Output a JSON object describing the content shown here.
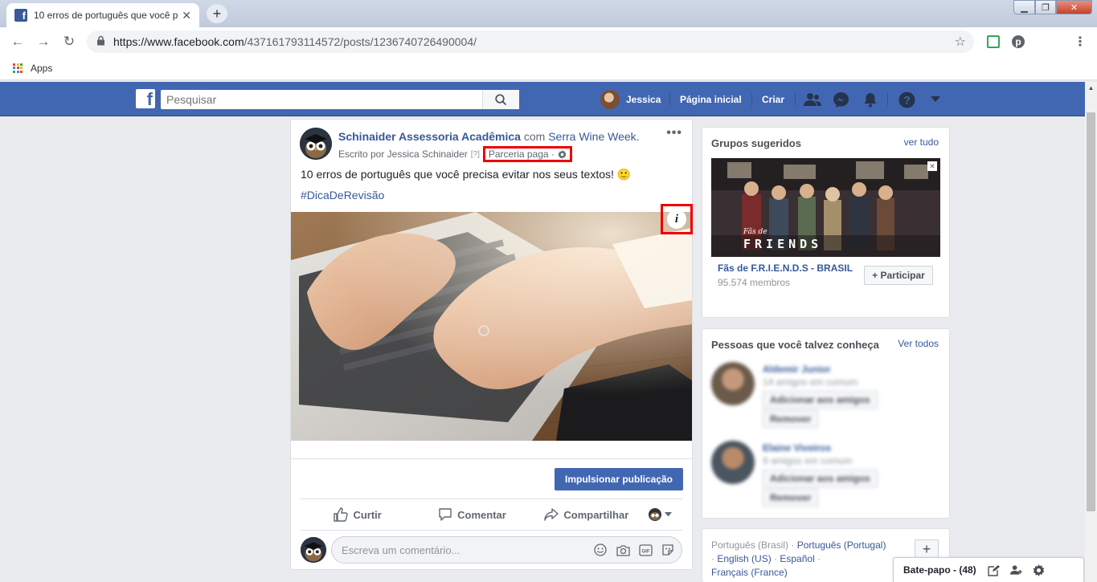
{
  "browser": {
    "tab_title": "10 erros de português que você p",
    "url_host": "https://www.facebook.com",
    "url_path": "/437161793114572/posts/1236740726490004/",
    "bookmarks_apps": "Apps"
  },
  "fb": {
    "search_placeholder": "Pesquisar",
    "user_name": "Jessica",
    "nav_home": "Página inicial",
    "nav_create": "Criar"
  },
  "post": {
    "page_name": "Schinaider Assessoria Acadêmica",
    "with_text": "com",
    "with_page": "Serra Wine Week.",
    "written_by": "Escrito por Jessica Schinaider",
    "written_by_help": "[?]",
    "paid_partnership": "Parceria paga ·",
    "text": "10 erros de português que você precisa evitar nos seus textos! 🙂",
    "hashtag": "#DicaDeRevisão",
    "boost_label": "Impulsionar publicação",
    "like_label": "Curtir",
    "comment_label": "Comentar",
    "share_label": "Compartilhar",
    "comment_placeholder": "Escreva um comentário..."
  },
  "groups": {
    "title": "Grupos sugeridos",
    "see_all": "ver tudo",
    "group_name": "Fãs de F.R.I.E.N.D.S - BRASIL",
    "members": "95.574 membros",
    "join_label": "+ Participar",
    "image_caption_top": "Fãs de",
    "image_caption_main": "FRIENDS"
  },
  "people": {
    "title": "Pessoas que você talvez conheça",
    "see_all": "Ver todos",
    "items": [
      {
        "name": "Aldemir Junior",
        "mutual": "14 amigos em comum",
        "add": "Adicionar aos amigos",
        "remove": "Remover"
      },
      {
        "name": "Elaine Viveiros",
        "mutual": "9 amigos em comum",
        "add": "Adicionar aos amigos",
        "remove": "Remover"
      }
    ]
  },
  "languages": {
    "current": "Português (Brasil)",
    "opt1": "Português (Portugal)",
    "opt2": "English (US)",
    "opt3": "Español",
    "opt4": "Français (France)",
    "add": "+"
  },
  "chat": {
    "label": "Bate-papo - (48)"
  },
  "colors": {
    "fb_blue": "#4267b2",
    "link_blue": "#365899",
    "highlight_red": "#ee0000"
  }
}
